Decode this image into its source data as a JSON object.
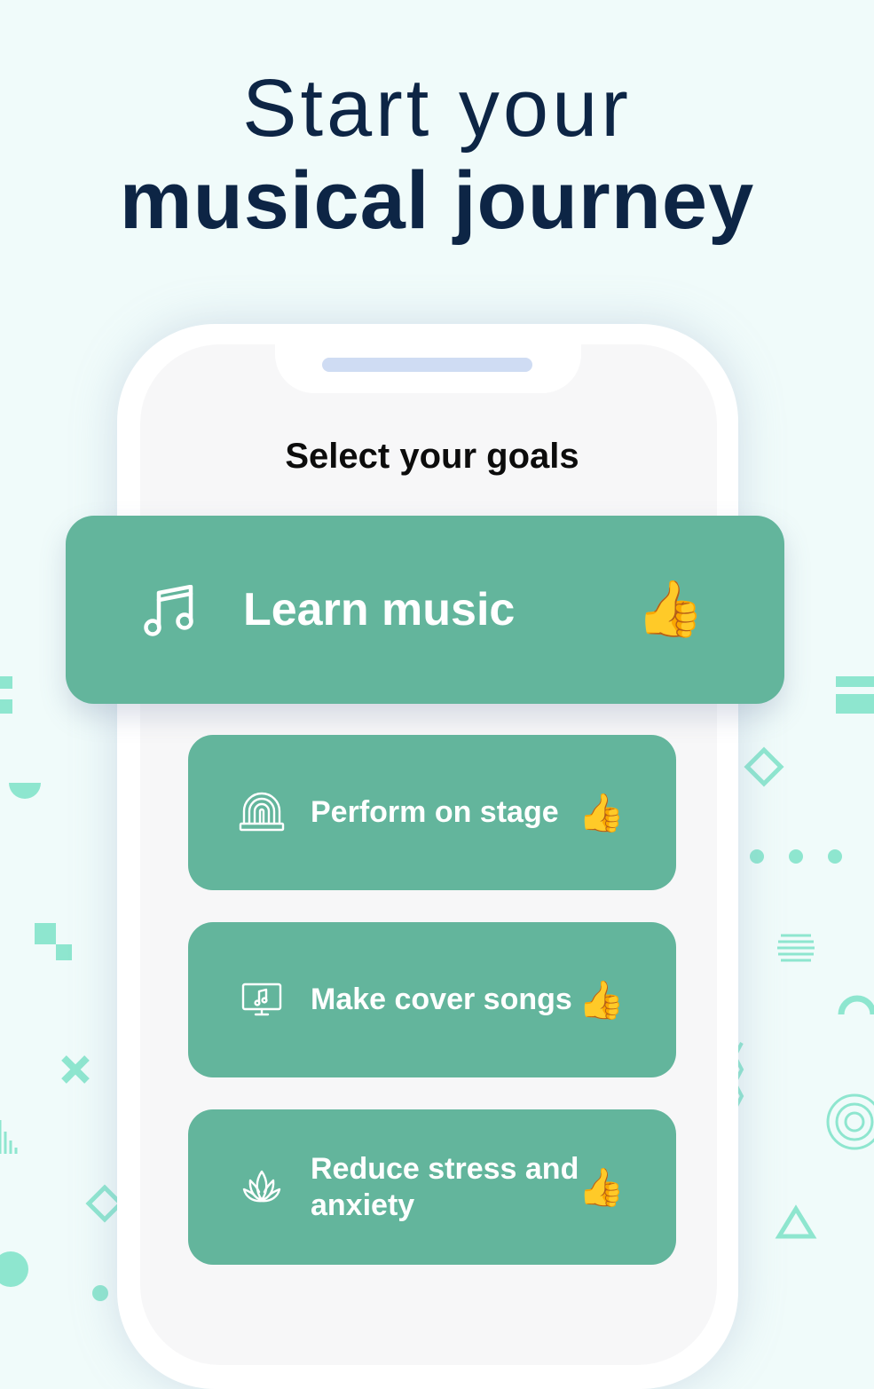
{
  "headline": {
    "line1": "Start your",
    "line2": "musical journey"
  },
  "screen": {
    "title": "Select your goals"
  },
  "goals": [
    {
      "label": "Learn music",
      "icon": "music-note-icon",
      "reaction": "👍"
    },
    {
      "label": "Perform on stage",
      "icon": "stage-icon",
      "reaction": "👍"
    },
    {
      "label": "Make cover songs",
      "icon": "screen-music-icon",
      "reaction": "👍"
    },
    {
      "label": "Reduce stress and anxiety",
      "icon": "lotus-icon",
      "reaction": "👍"
    }
  ],
  "colors": {
    "background": "#f0fbfa",
    "headline": "#0d2545",
    "goal_card": "#63b59c",
    "decoration": "#8ee6cf"
  }
}
